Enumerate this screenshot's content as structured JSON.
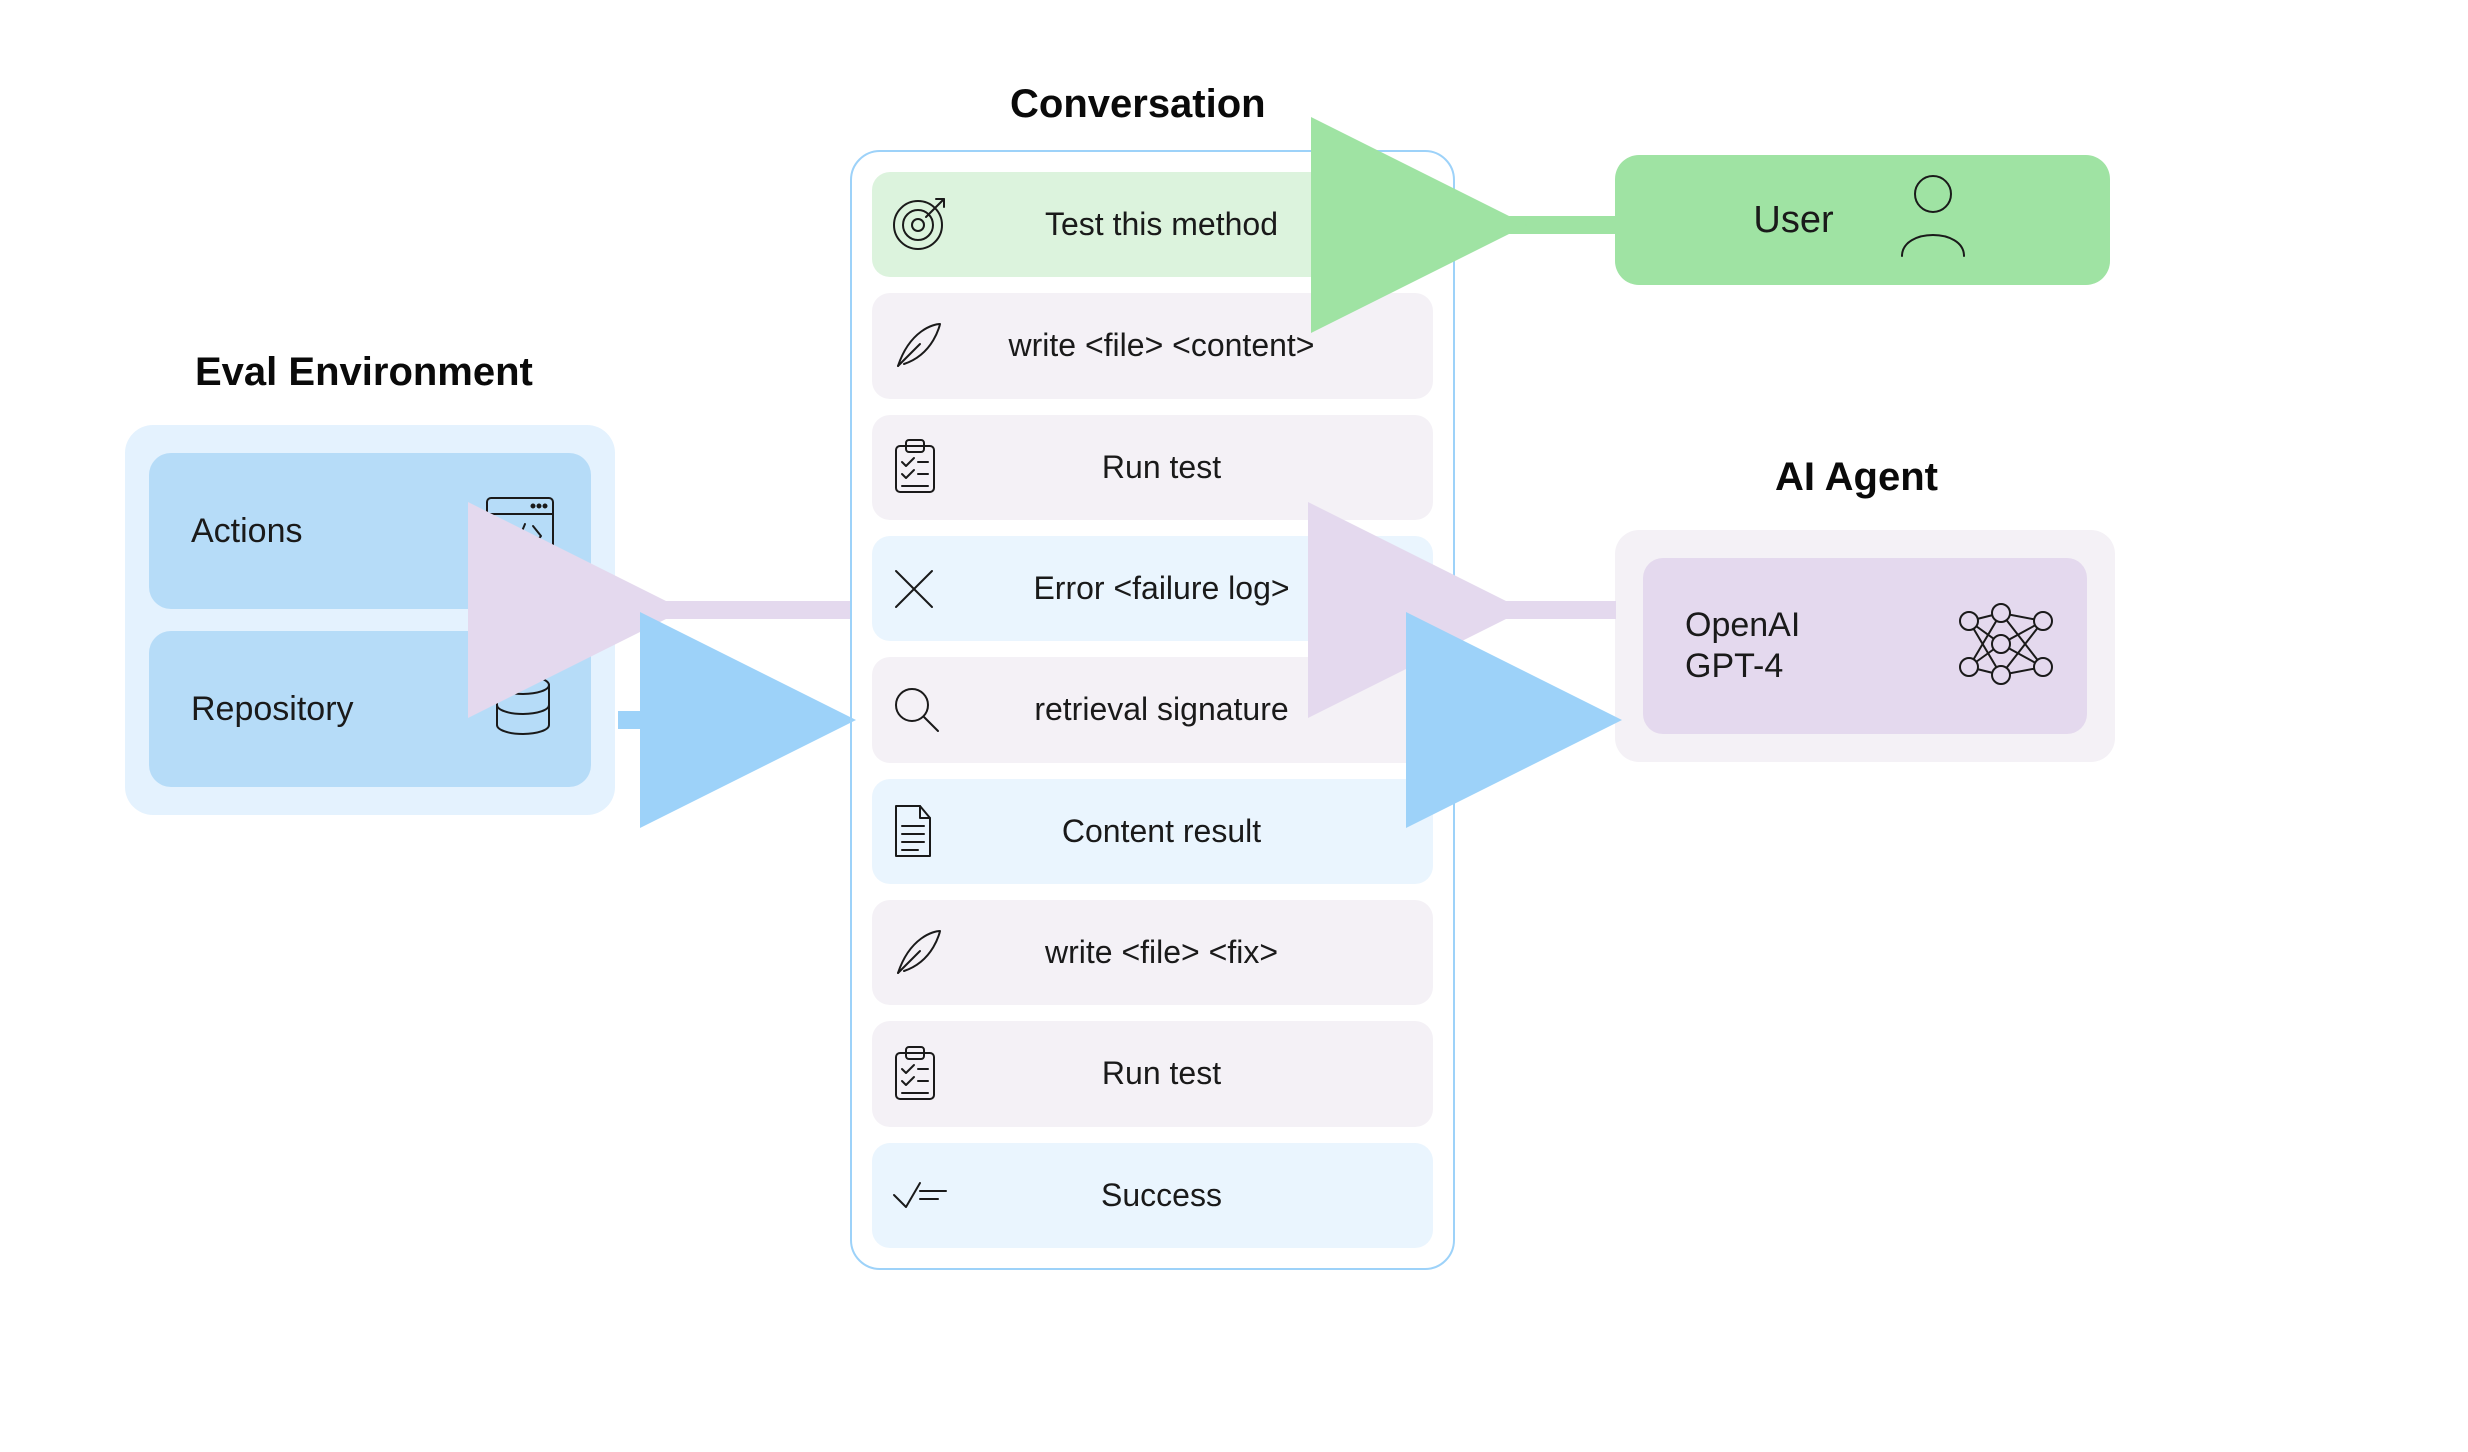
{
  "eval_env": {
    "title": "Eval Environment",
    "actions_label": "Actions",
    "repository_label": "Repository"
  },
  "conversation": {
    "title": "Conversation",
    "rows": [
      {
        "label": "Test this method",
        "icon": "target-icon",
        "color": "green"
      },
      {
        "label": "write <file> <content>",
        "icon": "quill-icon",
        "color": "purple"
      },
      {
        "label": "Run test",
        "icon": "clipboard-icon",
        "color": "purple"
      },
      {
        "label": "Error <failure log>",
        "icon": "x-icon",
        "color": "blue"
      },
      {
        "label": "retrieval signature",
        "icon": "search-icon",
        "color": "purple"
      },
      {
        "label": "Content result",
        "icon": "document-icon",
        "color": "blue"
      },
      {
        "label": "write <file> <fix>",
        "icon": "quill-icon",
        "color": "purple"
      },
      {
        "label": "Run test",
        "icon": "clipboard-icon",
        "color": "purple"
      },
      {
        "label": "Success",
        "icon": "check-icon",
        "color": "blue"
      }
    ]
  },
  "user": {
    "label": "User"
  },
  "ai_agent": {
    "title": "AI Agent",
    "model_line1": "OpenAI",
    "model_line2": "GPT-4"
  },
  "colors": {
    "eval_outer": "#E4F2FE",
    "eval_inner": "#B6DCF8",
    "conv_border": "#9DD2F9",
    "row_green": "#DCF3DD",
    "row_purple": "#F4F1F6",
    "row_blue": "#EAF5FE",
    "user_box": "#9FE3A3",
    "agent_outer": "#F4F1F6",
    "agent_inner": "#E4D9EE",
    "arrow_green": "#9FE3A3",
    "arrow_blue": "#9DD2F9",
    "arrow_purple": "#E4D9EE"
  }
}
